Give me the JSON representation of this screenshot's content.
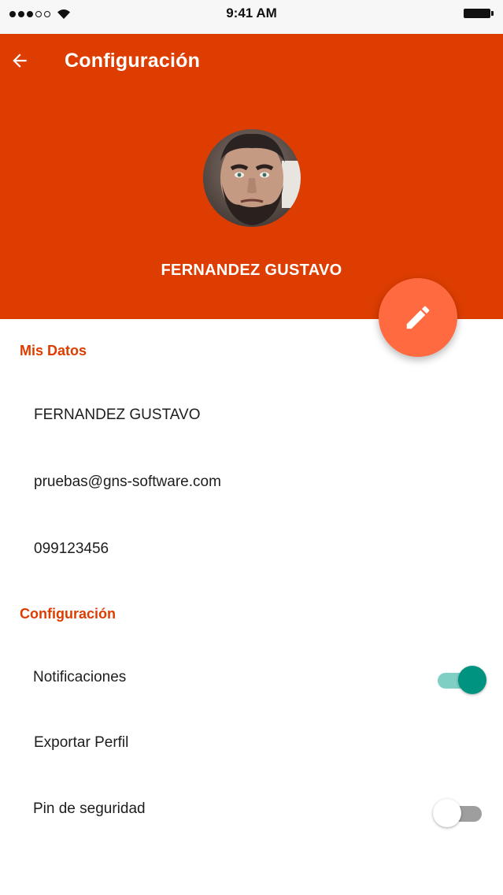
{
  "status_bar": {
    "time": "9:41 AM"
  },
  "header": {
    "title": "Configuración"
  },
  "profile": {
    "name": "FERNANDEZ GUSTAVO"
  },
  "sections": {
    "mis_datos": {
      "title": "Mis Datos",
      "name": "FERNANDEZ GUSTAVO",
      "email": "pruebas@gns-software.com",
      "phone": "099123456"
    },
    "configuracion": {
      "title": "Configuración",
      "notificaciones": "Notificaciones",
      "exportar": "Exportar Perfil",
      "pin": "Pin de seguridad"
    }
  },
  "switches": {
    "notificaciones_on": true,
    "pin_on": false
  },
  "colors": {
    "header": "#dd3d00",
    "fab": "#ff6a40",
    "accent_text": "#dd3d00",
    "switch_on": "#00937f",
    "switch_on_track": "#7fcfc4"
  },
  "icons": {
    "back": "arrow-left-icon",
    "edit": "pencil-icon",
    "signal": "signal-dots-icon",
    "wifi": "wifi-icon",
    "battery": "battery-icon"
  }
}
